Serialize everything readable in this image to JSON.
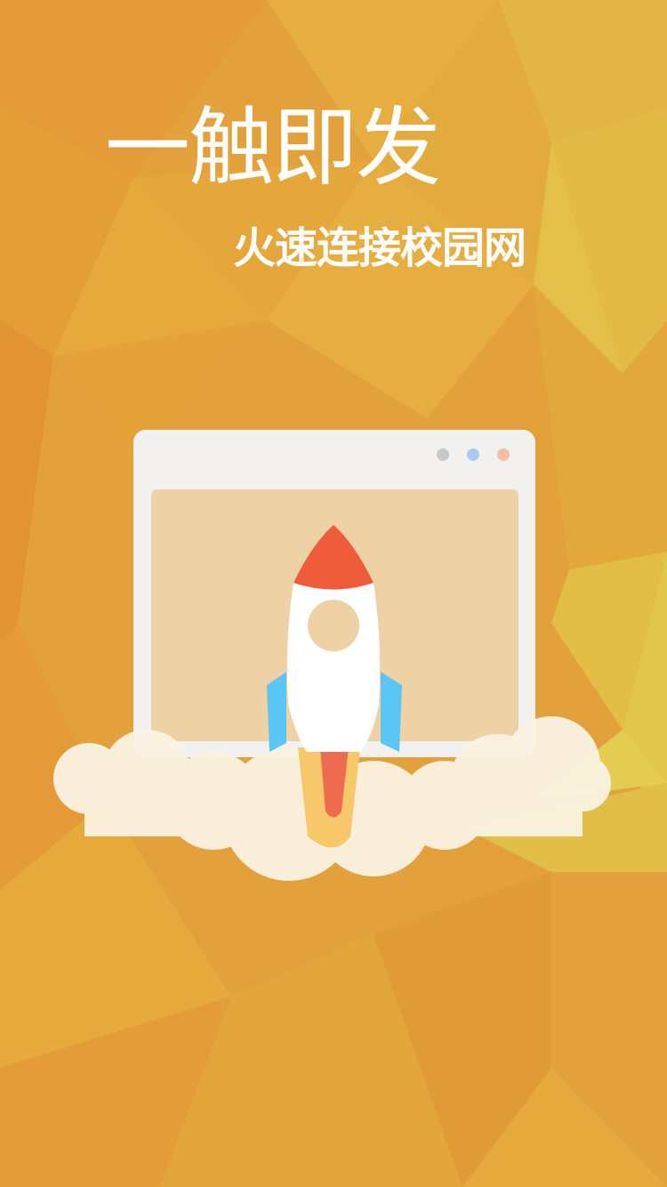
{
  "splash": {
    "title": "一触即发",
    "subtitle": "火速连接校园网"
  },
  "colors": {
    "background": "#E3A13C",
    "window_frame": "#F2F1F0",
    "window_screen": "#EED2A6",
    "rocket_body": "#FFFFFF",
    "rocket_nose": "#EE5C3B",
    "rocket_fins": "#5BC5F4",
    "flame_outer": "#F7C86A",
    "flame_inner": "#EE6B50",
    "cloud": "#FBF3E2",
    "dot_gray": "#C8C8C8",
    "dot_blue": "#A9CBEF",
    "dot_orange": "#F5BFA7"
  },
  "icons": [
    "rocket-icon",
    "browser-window-icon",
    "cloud-icon"
  ]
}
